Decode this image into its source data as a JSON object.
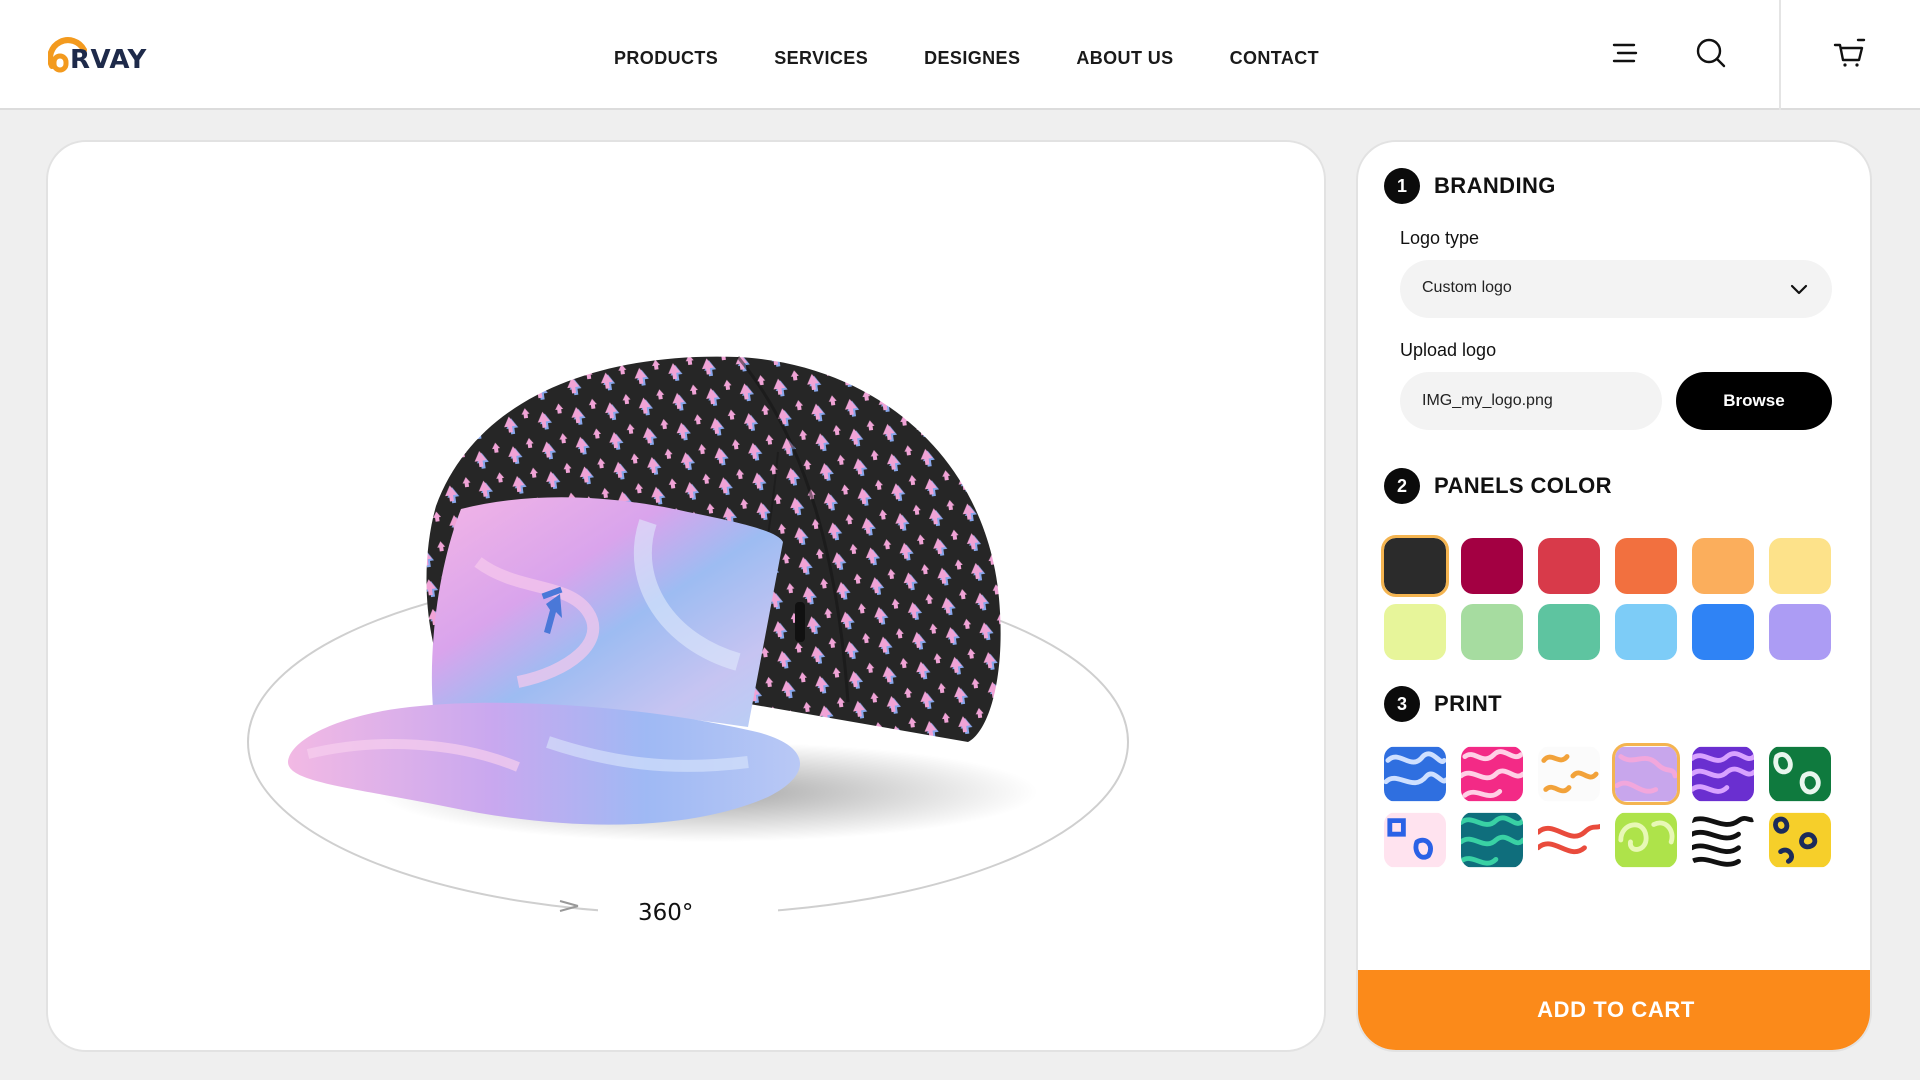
{
  "brand": {
    "logo_text": "RVAY"
  },
  "nav": [
    {
      "label": "PRODUCTS"
    },
    {
      "label": "SERVICES"
    },
    {
      "label": "DESIGNES"
    },
    {
      "label": "ABOUT US"
    },
    {
      "label": "CONTACT"
    }
  ],
  "header_icons": [
    "menu-icon",
    "search-icon",
    "cart-icon"
  ],
  "preview": {
    "rotation_label": "360°"
  },
  "config": {
    "branding": {
      "step": "1",
      "title": "BRANDING",
      "logo_type_label": "Logo type",
      "logo_type_value": "Custom logo",
      "upload_label": "Upload logo",
      "upload_value": "IMG_my_logo.png",
      "browse_label": "Browse"
    },
    "panels_color": {
      "step": "2",
      "title": "PANELS COLOR",
      "selected_index": 0,
      "colors": [
        "#2b2b2b",
        "#a30042",
        "#d83a4a",
        "#f2703f",
        "#fbae5c",
        "#fde28a",
        "#e7f59a",
        "#a6dca0",
        "#5ec4a0",
        "#7dccf7",
        "#2f83f5",
        "#ac9cf4"
      ]
    },
    "print": {
      "step": "3",
      "title": "PRINT",
      "selected_index": 3,
      "patterns": [
        "blue-swirl",
        "pink-maze",
        "colorful-squiggles",
        "pink-marble",
        "purple-waves",
        "green-blobs",
        "colorful-shapes",
        "teal-waves",
        "rainbow-lines",
        "lime-swirl",
        "black-zebra",
        "yellow-leopard"
      ]
    },
    "add_to_cart_label": "ADD TO CART"
  }
}
